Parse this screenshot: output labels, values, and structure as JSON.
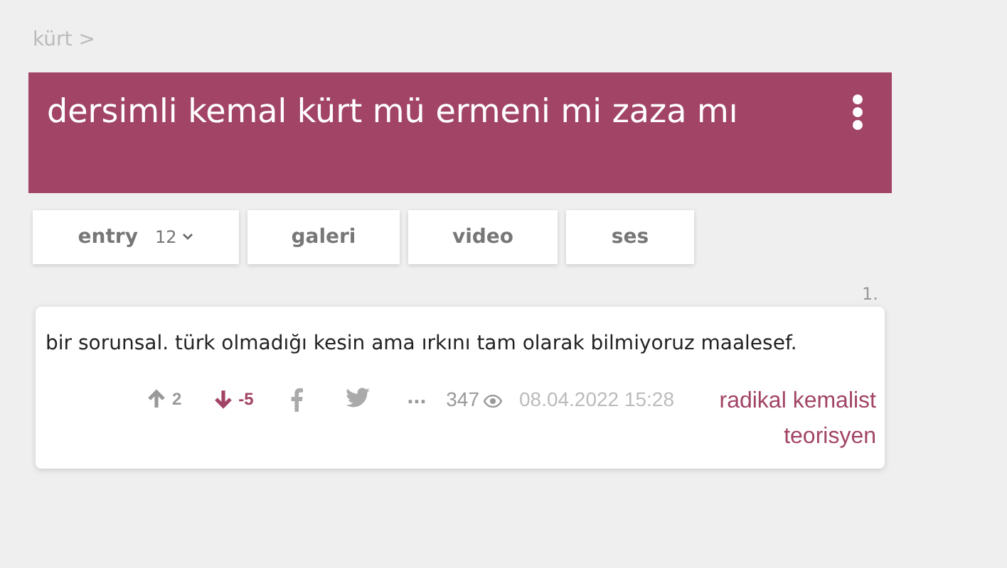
{
  "breadcrumb": {
    "label": "kürt",
    "separator": ">"
  },
  "topic": {
    "title": "dersimli kemal kürt mü ermeni mi zaza mı"
  },
  "tabs": [
    {
      "label": "entry",
      "count": "12",
      "selected": false
    },
    {
      "label": "galeri",
      "selected": false
    },
    {
      "label": "video",
      "selected": false
    },
    {
      "label": "ses",
      "selected": false
    }
  ],
  "entry": {
    "number": "1.",
    "text": "bir sorunsal. türk olmadığı kesin ama ırkını tam olarak bilmiyoruz maalesef.",
    "votes": [
      {
        "kind": "up",
        "count": "2",
        "selected": false
      },
      {
        "kind": "down",
        "count": "-5",
        "selected": true
      }
    ],
    "more": "...",
    "views": "347",
    "date": "08.04.2022 15:28",
    "author": "radikal kemalist teorisyen"
  }
}
